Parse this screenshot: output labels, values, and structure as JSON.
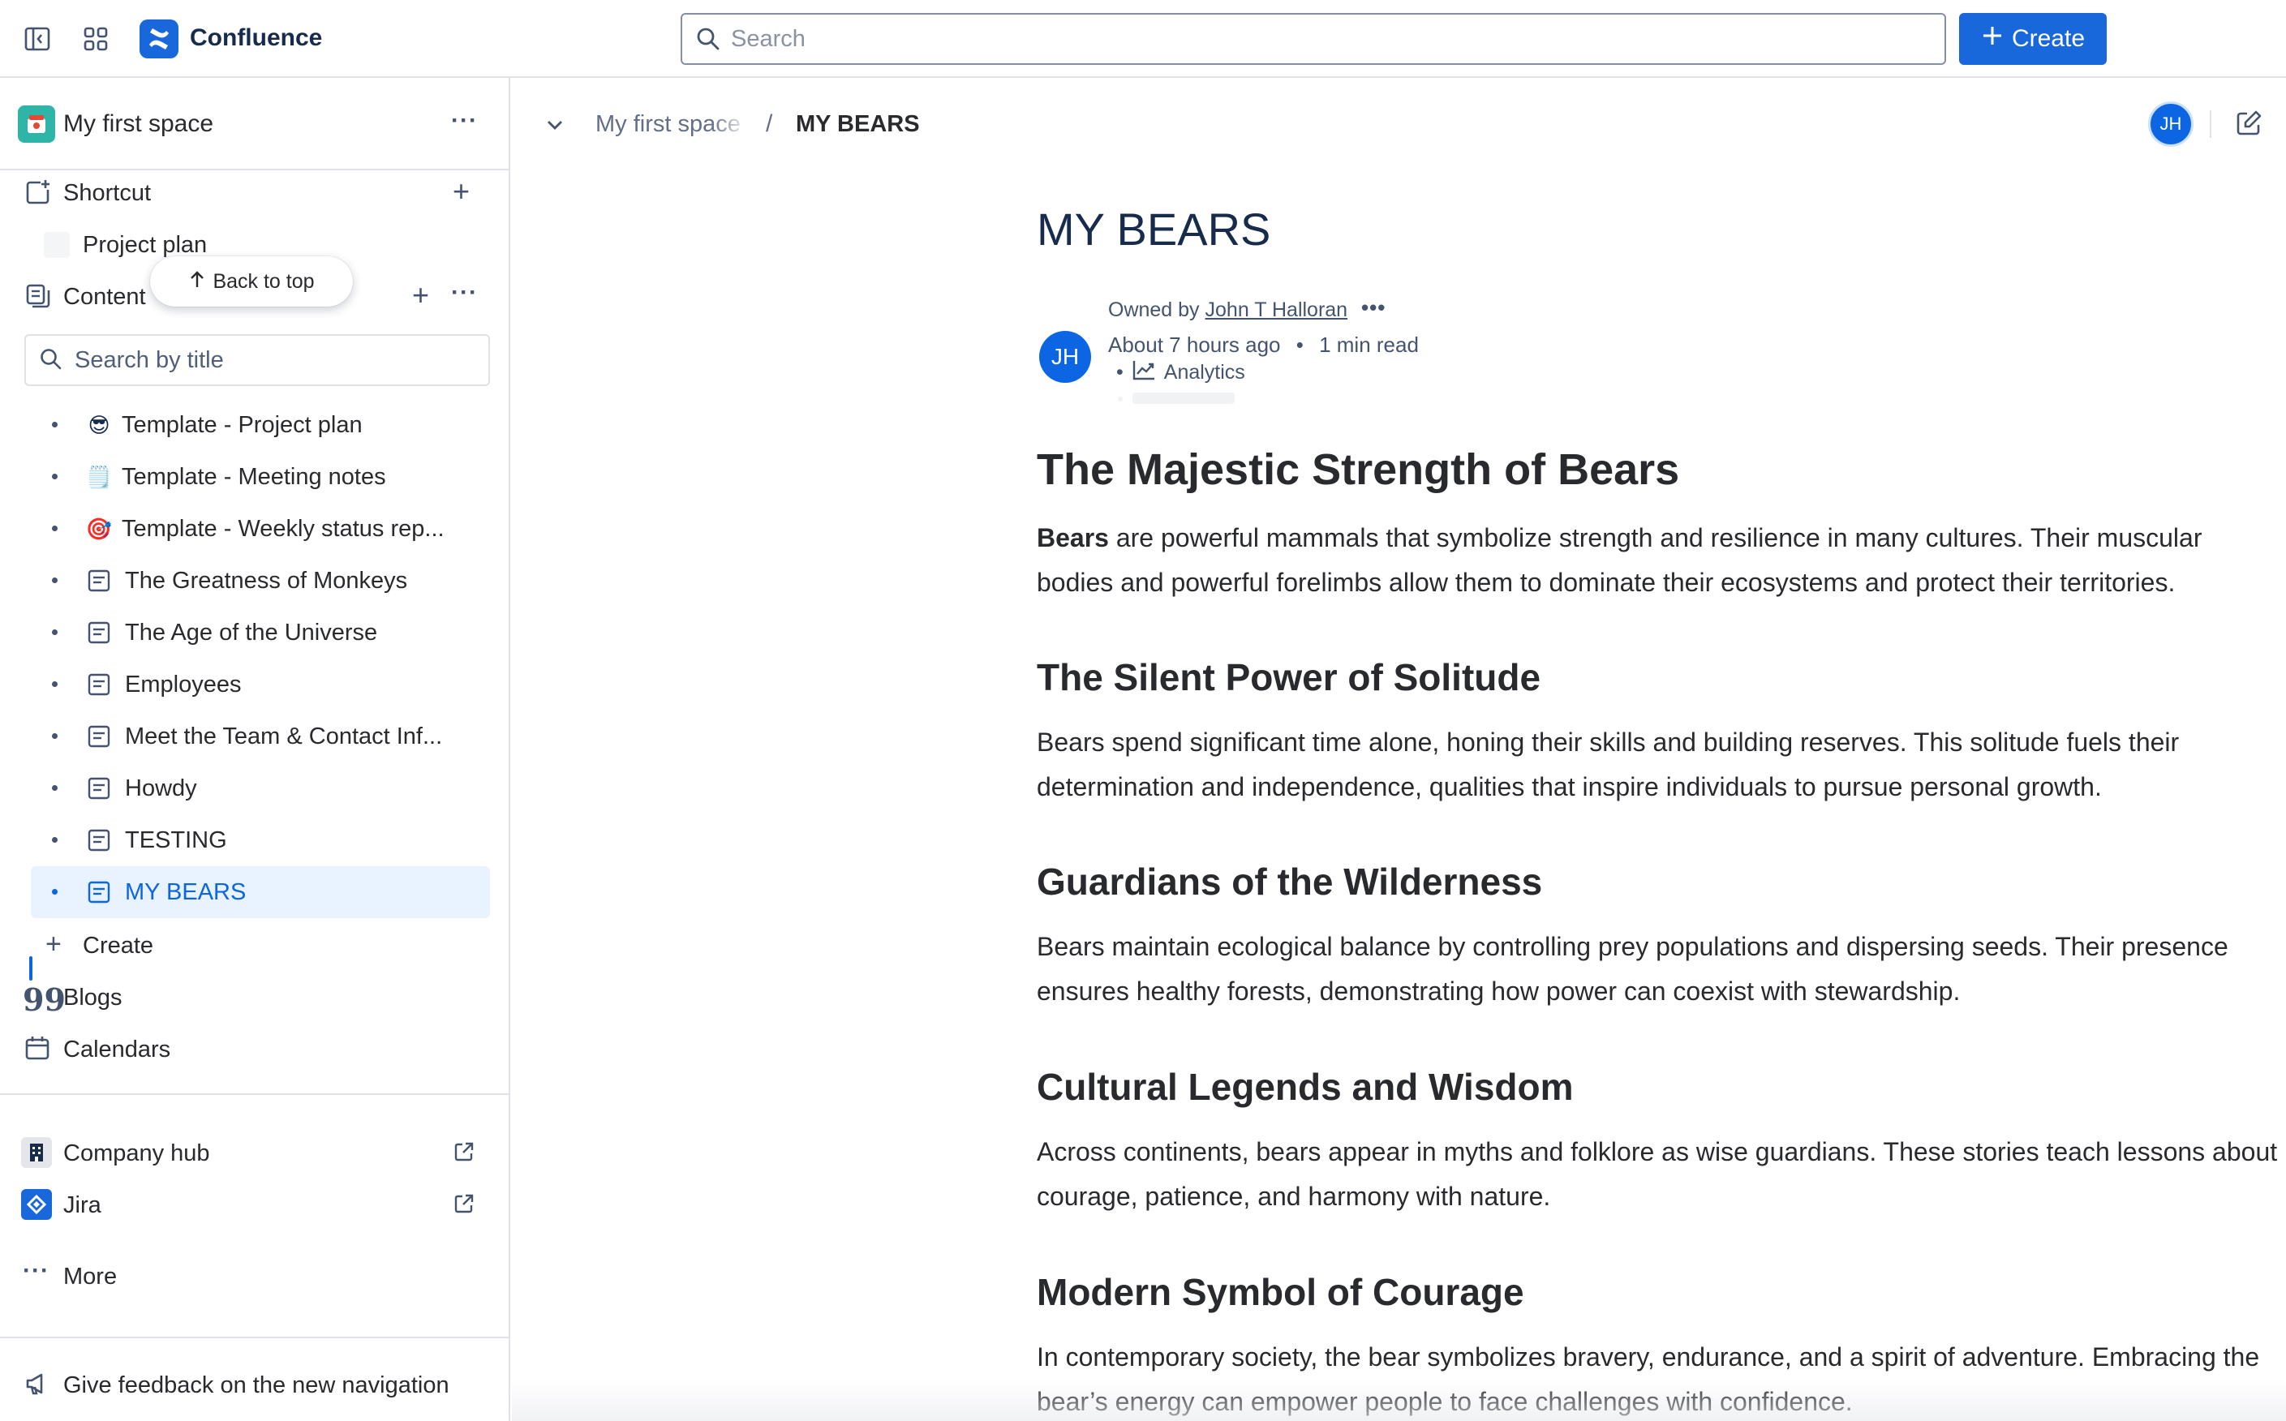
{
  "app": {
    "title": "Confluence"
  },
  "topbar": {
    "search_placeholder": "Search",
    "create_label": "Create",
    "icons": [
      "sidebar-toggle-icon",
      "app-switcher-icon",
      "confluence-logo-icon",
      "search-icon",
      "plus-icon"
    ]
  },
  "sidebar": {
    "space_name": "My first space",
    "shortcuts_label": "Shortcut",
    "shortcut_items": [
      {
        "label": "Project plan"
      }
    ],
    "back_to_top_label": "Back to top",
    "content_label": "Content",
    "title_search_placeholder": "Search by title",
    "tree": [
      {
        "label": "Template - Project plan",
        "icon": "😎"
      },
      {
        "label": "Template - Meeting notes",
        "icon": "🗒️"
      },
      {
        "label": "Template - Weekly status rep...",
        "icon": "🎯"
      },
      {
        "label": "The Greatness of Monkeys",
        "icon": "page-icon"
      },
      {
        "label": "The Age of the Universe",
        "icon": "page-icon"
      },
      {
        "label": "Employees",
        "icon": "page-icon"
      },
      {
        "label": "Meet the Team & Contact Inf...",
        "icon": "page-icon"
      },
      {
        "label": "Howdy",
        "icon": "page-icon"
      },
      {
        "label": "TESTING",
        "icon": "page-icon"
      },
      {
        "label": "MY BEARS",
        "icon": "page-icon",
        "active": true
      }
    ],
    "create_label": "Create",
    "blogs_label": "Blogs",
    "calendars_label": "Calendars",
    "company_hub_label": "Company hub",
    "jira_label": "Jira",
    "more_label": "More",
    "feedback_label": "Give feedback on the new navigation"
  },
  "breadcrumb": {
    "space": "My first space",
    "separator": "/",
    "current": "MY BEARS"
  },
  "user": {
    "initials": "JH"
  },
  "page": {
    "title": "MY BEARS",
    "owned_by_prefix": "Owned by ",
    "owner": "John T Halloran",
    "updated": "About 7 hours ago",
    "read_time": "1 min read",
    "analytics_label": "Analytics",
    "sections": [
      {
        "heading": "The Majestic Strength of Bears",
        "bold_lead": "Bears",
        "text": " are powerful mammals that symbolize strength and resilience in many cultures. Their muscular bodies and powerful forelimbs allow them to dominate their ecosystems and protect their territories."
      },
      {
        "heading": "The Silent Power of Solitude",
        "text": "Bears spend significant time alone, honing their skills and building reserves. This solitude fuels their determination and independence, qualities that inspire individuals to pursue personal growth."
      },
      {
        "heading": "Guardians of the Wilderness",
        "text": "Bears maintain ecological balance by controlling prey populations and dispersing seeds. Their presence ensures healthy forests, demonstrating how power can coexist with stewardship."
      },
      {
        "heading": "Cultural Legends and Wisdom",
        "text": "Across continents, bears appear in myths and folklore as wise guardians. These stories teach lessons about courage, patience, and harmony with nature."
      },
      {
        "heading": "Modern Symbol of Courage",
        "text": "In contemporary society, the bear symbolizes bravery, endurance, and a spirit of adventure. Embracing the bear’s energy can empower people to face challenges with confidence."
      }
    ]
  },
  "colors": {
    "brand": "#1868db",
    "active_bg": "#e9f2ff",
    "active_text": "#0c66e4",
    "text": "#292a2e",
    "border": "#dfe1e6"
  }
}
